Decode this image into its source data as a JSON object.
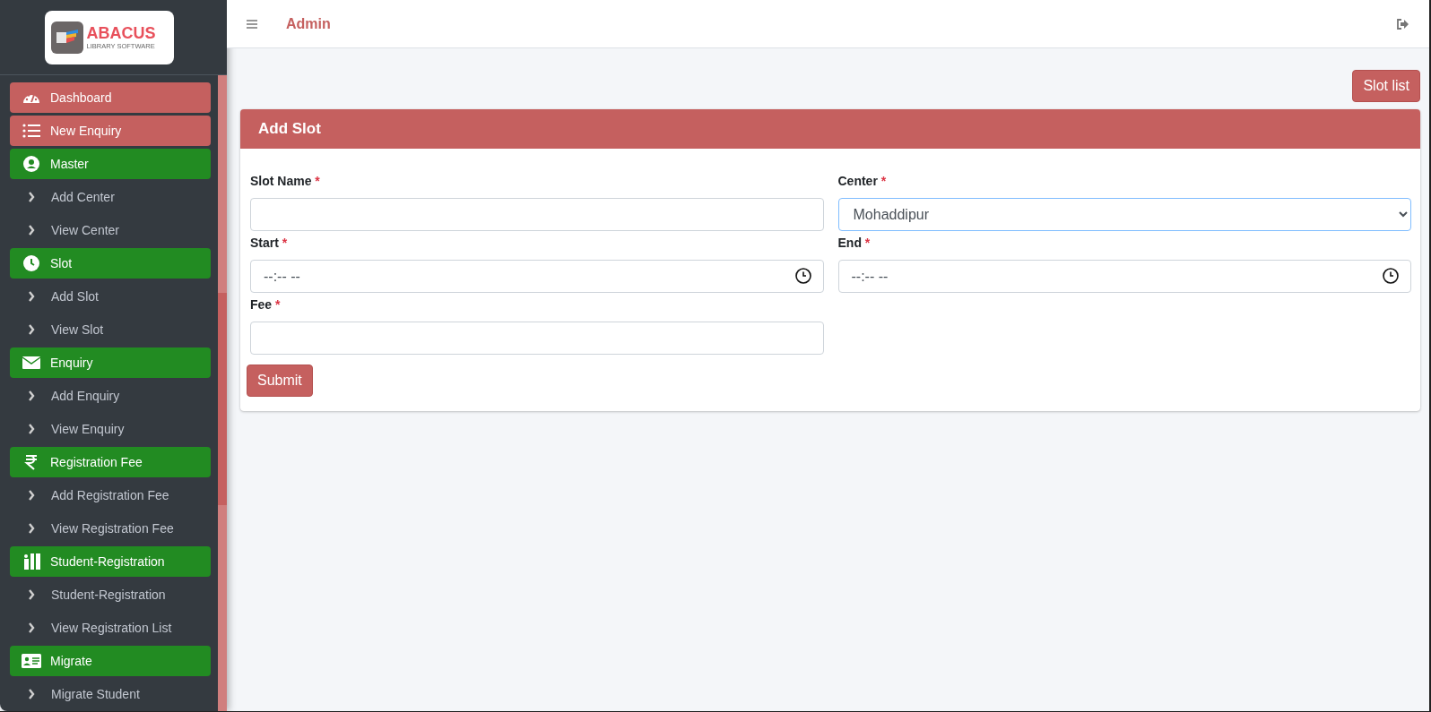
{
  "logo": {
    "title": "ABACUS",
    "subtitle": "LIBRARY SOFTWARE"
  },
  "sidebar": {
    "items": [
      {
        "label": "Dashboard",
        "kind": "highlight"
      },
      {
        "label": "New Enquiry",
        "kind": "highlight"
      },
      {
        "label": "Master",
        "kind": "group"
      },
      {
        "label": "Add Center",
        "kind": "sub"
      },
      {
        "label": "View Center",
        "kind": "sub"
      },
      {
        "label": "Slot",
        "kind": "group"
      },
      {
        "label": "Add Slot",
        "kind": "sub"
      },
      {
        "label": "View Slot",
        "kind": "sub"
      },
      {
        "label": "Enquiry",
        "kind": "group"
      },
      {
        "label": "Add Enquiry",
        "kind": "sub"
      },
      {
        "label": "View Enquiry",
        "kind": "sub"
      },
      {
        "label": "Registration Fee",
        "kind": "group"
      },
      {
        "label": "Add Registration Fee",
        "kind": "sub"
      },
      {
        "label": "View Registration Fee",
        "kind": "sub"
      },
      {
        "label": "Student-Registration",
        "kind": "group"
      },
      {
        "label": "Student-Registration",
        "kind": "sub"
      },
      {
        "label": "View Registration List",
        "kind": "sub"
      },
      {
        "label": "Migrate",
        "kind": "group"
      },
      {
        "label": "Migrate Student",
        "kind": "sub"
      }
    ]
  },
  "header": {
    "title": "Admin"
  },
  "slot_list_button": "Slot list",
  "card": {
    "title": "Add Slot",
    "fields": [
      {
        "label": "Slot Name",
        "required": "*",
        "kind": "text"
      },
      {
        "label": "Center",
        "required": "*",
        "kind": "select",
        "value": "Mohaddipur"
      },
      {
        "label": "Start",
        "required": "*",
        "kind": "time",
        "placeholder": "--:-- --"
      },
      {
        "label": "End",
        "required": "*",
        "kind": "time",
        "placeholder": "--:-- --"
      },
      {
        "label": "Fee",
        "required": "*",
        "kind": "text"
      }
    ],
    "submit": "Submit"
  }
}
